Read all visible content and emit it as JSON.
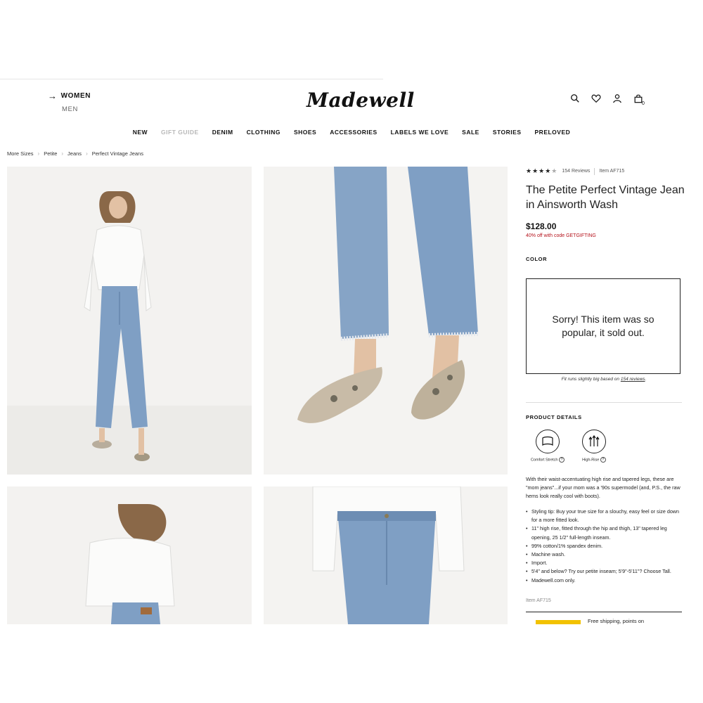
{
  "header": {
    "genders": {
      "women": "WOMEN",
      "men": "MEN"
    },
    "logo": "Madewell",
    "bag_count": "0"
  },
  "nav": [
    "NEW",
    "GIFT GUIDE",
    "DENIM",
    "CLOTHING",
    "SHOES",
    "ACCESSORIES",
    "LABELS WE LOVE",
    "SALE",
    "STORIES",
    "PRELOVED"
  ],
  "breadcrumbs": [
    "More Sizes",
    "Petite",
    "Jeans",
    "Perfect Vintage Jeans"
  ],
  "product": {
    "rating_stars": 4.5,
    "reviews_count": "154 Reviews",
    "item_number": "Item AF715",
    "title": "The Petite Perfect Vintage Jean in Ainsworth Wash",
    "price": "$128.00",
    "promo": "40% off with code GETGIFTING",
    "color_label": "COLOR",
    "sold_out_message": "Sorry! This item was so popular, it sold out.",
    "fit_note_prefix": "Fit runs slightly big based on",
    "fit_note_link": "154 reviews",
    "fit_note_suffix": ".",
    "details_label": "PRODUCT DETAILS",
    "features": [
      {
        "label": "Comfort Stretch",
        "icon": "comfort-stretch-icon"
      },
      {
        "label": "High-Rise",
        "icon": "high-rise-icon"
      }
    ],
    "description": "With their waist-accentuating high rise and tapered legs, these are \"mom jeans\"...if your mom was a '90s supermodel (and, P.S., the raw hems look really cool with boots).",
    "bullets": [
      "Styling tip: Buy your true size for a slouchy, easy feel or size down for a more fitted look.",
      "11\" high rise, fitted through the hip and thigh, 13\" tapered leg opening, 25 1/2\" full-length inseam.",
      "99% cotton/1% spandex denim.",
      "Machine wash.",
      "Import.",
      "5'4\" and below? Try our petite inseam; 5'9\"-5'11\"? Choose Tall.",
      "Madewell.com only."
    ],
    "item_number_footer": "Item AF715",
    "shipping_teaser": "Free shipping, points on"
  },
  "colors": {
    "promo": "#b5121b",
    "accent_yellow": "#f2c200",
    "denim": "#7f9fc4"
  }
}
